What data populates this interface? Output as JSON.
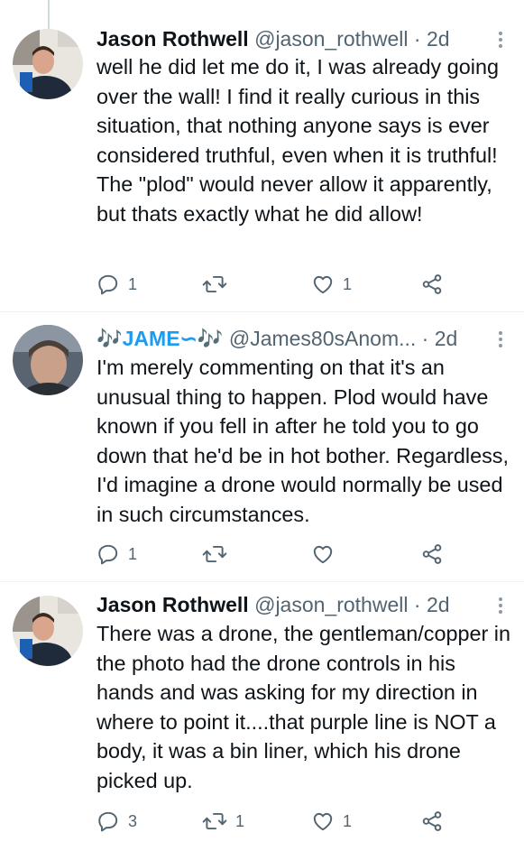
{
  "tweets": [
    {
      "name": "Jason Rothwell",
      "handle": "@jason_rothwell",
      "dot": "·",
      "time": "2d",
      "text": "well he did let me do it, I was already going over the wall! I find it really curious in this situation, that nothing anyone says is ever considered truthful, even when it is truthful! The \"plod\" would never allow it apparently, but thats exactly what he did allow!",
      "replies": "1",
      "retweets": "",
      "likes": "1"
    },
    {
      "name": "🎶JAME∽🎶",
      "handle": "@James80sAnom...",
      "dot": "·",
      "time": "2d",
      "text": "I'm merely commenting on that it's an unusual thing to happen. Plod would have known if you fell in after he told you to go down that he'd be in hot bother. Regardless, I'd imagine a drone would normally be used in such circumstances.",
      "replies": "1",
      "retweets": "",
      "likes": ""
    },
    {
      "name": "Jason Rothwell",
      "handle": "@jason_rothwell",
      "dot": "·",
      "time": "2d",
      "text": "There was a drone, the gentleman/copper in the photo had the drone controls in his hands and was asking for my direction in where to point it....that purple line is NOT a body, it was a bin liner, which his drone picked up.",
      "replies": "3",
      "retweets": "1",
      "likes": "1"
    }
  ],
  "icons": {
    "reply": "reply-icon",
    "retweet": "retweet-icon",
    "like": "heart-icon",
    "share": "share-icon",
    "more": "more-icon"
  },
  "colors": {
    "text": "#0f1419",
    "secondary": "#536471",
    "thread_line": "#cfd9de",
    "accent": "#1d9bf0"
  }
}
